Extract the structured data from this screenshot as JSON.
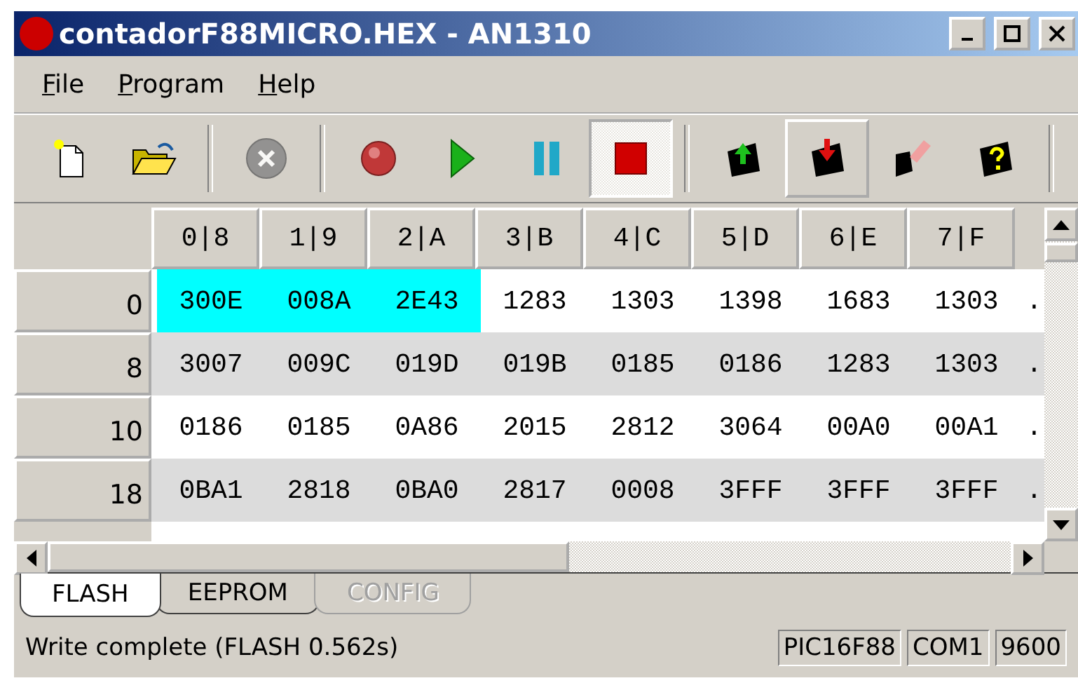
{
  "window": {
    "title": "contadorF88MICRO.HEX - AN1310"
  },
  "menu": [
    {
      "label": "File"
    },
    {
      "label": "Program"
    },
    {
      "label": "Help"
    }
  ],
  "toolbar": [
    {
      "kind": "new",
      "pressed": false,
      "disabled": false
    },
    {
      "kind": "open",
      "pressed": false,
      "disabled": false
    },
    {
      "kind": "separator"
    },
    {
      "kind": "abort",
      "pressed": false,
      "disabled": true
    },
    {
      "kind": "separator"
    },
    {
      "kind": "record",
      "pressed": false,
      "disabled": false
    },
    {
      "kind": "run",
      "pressed": false,
      "disabled": false
    },
    {
      "kind": "pause",
      "pressed": false,
      "disabled": false
    },
    {
      "kind": "stop",
      "pressed": true,
      "disabled": false
    },
    {
      "kind": "separator"
    },
    {
      "kind": "read",
      "pressed": false,
      "disabled": false
    },
    {
      "kind": "write",
      "pressed": false,
      "disabled": false,
      "hover": true
    },
    {
      "kind": "erase",
      "pressed": false,
      "disabled": false
    },
    {
      "kind": "verify",
      "pressed": false,
      "disabled": false
    },
    {
      "kind": "separator"
    }
  ],
  "grid": {
    "columns": [
      "0|8",
      "1|9",
      "2|A",
      "3|B",
      "4|C",
      "5|D",
      "6|E",
      "7|F"
    ],
    "rows": [
      {
        "address": "0",
        "more": ".",
        "cells": [
          {
            "value": "300E",
            "selected": true
          },
          {
            "value": "008A",
            "selected": true
          },
          {
            "value": "2E43",
            "selected": true
          },
          {
            "value": "1283",
            "selected": false
          },
          {
            "value": "1303",
            "selected": false
          },
          {
            "value": "1398",
            "selected": false
          },
          {
            "value": "1683",
            "selected": false
          },
          {
            "value": "1303",
            "selected": false
          }
        ]
      },
      {
        "address": "8",
        "more": ".",
        "cells": [
          {
            "value": "3007",
            "selected": false
          },
          {
            "value": "009C",
            "selected": false
          },
          {
            "value": "019D",
            "selected": false
          },
          {
            "value": "019B",
            "selected": false
          },
          {
            "value": "0185",
            "selected": false
          },
          {
            "value": "0186",
            "selected": false
          },
          {
            "value": "1283",
            "selected": false
          },
          {
            "value": "1303",
            "selected": false
          }
        ]
      },
      {
        "address": "10",
        "more": ".",
        "cells": [
          {
            "value": "0186",
            "selected": false
          },
          {
            "value": "0185",
            "selected": false
          },
          {
            "value": "0A86",
            "selected": false
          },
          {
            "value": "2015",
            "selected": false
          },
          {
            "value": "2812",
            "selected": false
          },
          {
            "value": "3064",
            "selected": false
          },
          {
            "value": "00A0",
            "selected": false
          },
          {
            "value": "00A1",
            "selected": false
          }
        ]
      },
      {
        "address": "18",
        "more": ".",
        "cells": [
          {
            "value": "0BA1",
            "selected": false
          },
          {
            "value": "2818",
            "selected": false
          },
          {
            "value": "0BA0",
            "selected": false
          },
          {
            "value": "2817",
            "selected": false
          },
          {
            "value": "0008",
            "selected": false
          },
          {
            "value": "3FFF",
            "selected": false
          },
          {
            "value": "3FFF",
            "selected": false
          },
          {
            "value": "3FFF",
            "selected": false
          }
        ]
      }
    ]
  },
  "tabs": [
    {
      "label": "FLASH",
      "selected": true,
      "disabled": false
    },
    {
      "label": "EEPROM",
      "selected": false,
      "disabled": false
    },
    {
      "label": "CONFIG",
      "selected": false,
      "disabled": true
    }
  ],
  "status_bar": {
    "message": "Write complete (FLASH 0.562s)",
    "panels": [
      "PIC16F88",
      "COM1",
      "9600"
    ]
  }
}
